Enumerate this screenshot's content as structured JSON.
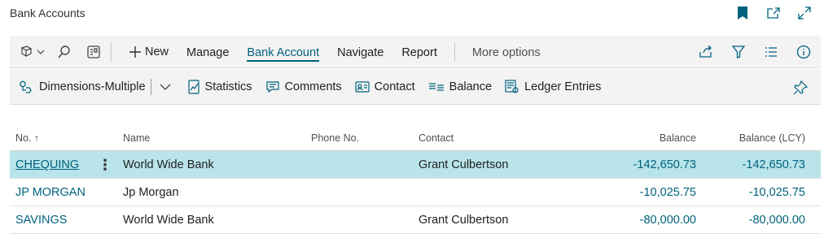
{
  "page": {
    "title": "Bank Accounts"
  },
  "title_actions": [
    {
      "name": "bookmark-icon"
    },
    {
      "name": "open-new-window-icon"
    },
    {
      "name": "expand-icon"
    }
  ],
  "actionbar": {
    "new_label": "New",
    "manage_label": "Manage",
    "bank_account_label": "Bank Account",
    "navigate_label": "Navigate",
    "report_label": "Report",
    "more_label": "More options"
  },
  "subbar": {
    "dimensions_label": "Dimensions-Multiple",
    "statistics_label": "Statistics",
    "comments_label": "Comments",
    "contact_label": "Contact",
    "balance_label": "Balance",
    "ledger_label": "Ledger Entries"
  },
  "columns": {
    "no": "No. ↑",
    "name": "Name",
    "phone": "Phone No.",
    "contact": "Contact",
    "balance": "Balance",
    "balance_lcy": "Balance (LCY)"
  },
  "rows": [
    {
      "no": "CHEQUING",
      "name": "World Wide Bank",
      "phone": "",
      "contact": "Grant Culbertson",
      "balance": "-142,650.73",
      "balance_lcy": "-142,650.73",
      "selected": true
    },
    {
      "no": "JP MORGAN",
      "name": "Jp Morgan",
      "phone": "",
      "contact": "",
      "balance": "-10,025.75",
      "balance_lcy": "-10,025.75",
      "selected": false
    },
    {
      "no": "SAVINGS",
      "name": "World Wide Bank",
      "phone": "",
      "contact": "Grant Culbertson",
      "balance": "-80,000.00",
      "balance_lcy": "-80,000.00",
      "selected": false
    }
  ],
  "colors": {
    "accent": "#00627e",
    "selected_row": "#b8e4ea",
    "bar": "#f3f3f3"
  }
}
